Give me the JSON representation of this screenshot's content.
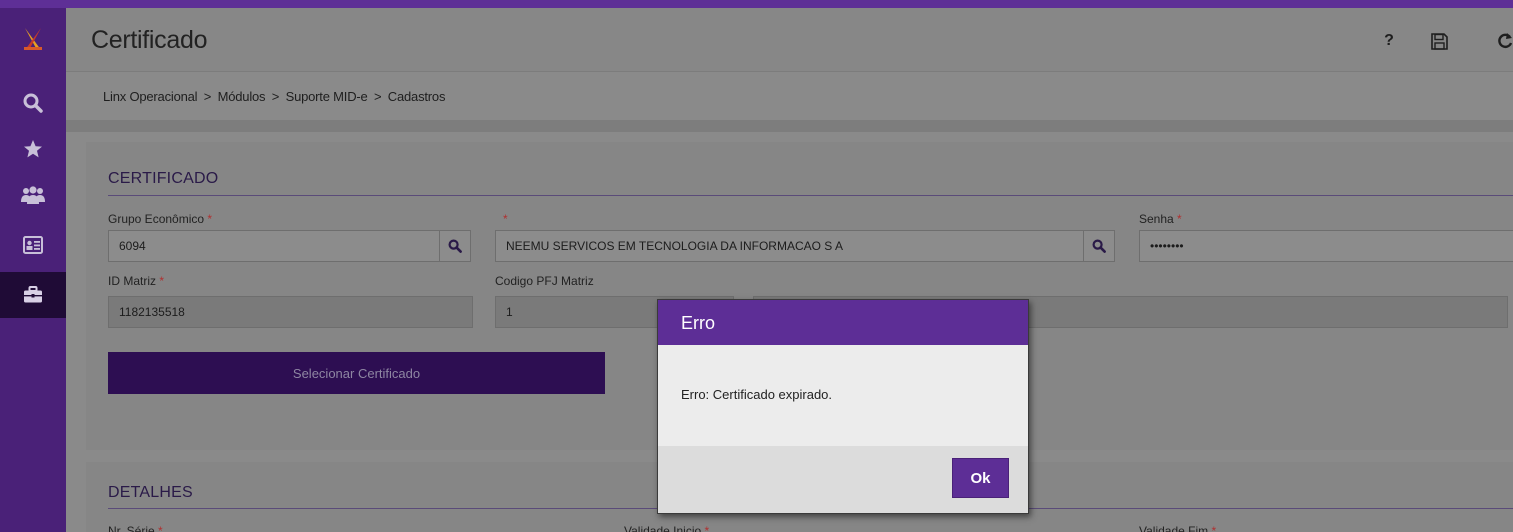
{
  "header": {
    "title": "Certificado",
    "help_label": "?"
  },
  "icons": {
    "logo": "linx-logo-icon",
    "search": "search-icon",
    "favorites": "star-icon",
    "users": "users-icon",
    "contact": "id-card-icon",
    "modules": "briefcase-icon",
    "save": "save-icon",
    "undo": "undo-icon"
  },
  "breadcrumb": {
    "items": [
      "Linx Operacional",
      "Módulos",
      "Suporte MID-e",
      "Cadastros"
    ],
    "separator": ">"
  },
  "certificado": {
    "section_title": "CERTIFICADO",
    "grupo_label": "Grupo Econômico",
    "grupo_value": "6094",
    "empresa_label": "",
    "empresa_value": "NEEMU SERVICOS EM TECNOLOGIA DA INFORMACAO S A",
    "senha_label": "Senha",
    "senha_value": "••••••••",
    "id_matriz_label": "ID Matriz",
    "id_matriz_value": "1182135518",
    "pfj_label": "Codigo PFJ Matriz",
    "pfj_value": "1",
    "select_button": "Selecionar Certificado",
    "required_mark": "*"
  },
  "detalhes": {
    "section_title": "DETALHES",
    "serie_label": "Nr. Série",
    "validade_inicio_label": "Validade Inicio",
    "validade_fim_label": "Validade Fim"
  },
  "modal": {
    "title": "Erro",
    "message": "Erro: Certificado expirado.",
    "ok_label": "Ok"
  },
  "colors": {
    "brand": "#5d2e96",
    "sidebar": "#4a2178",
    "primary_button": "#2d0e52",
    "required": "#b03030"
  }
}
